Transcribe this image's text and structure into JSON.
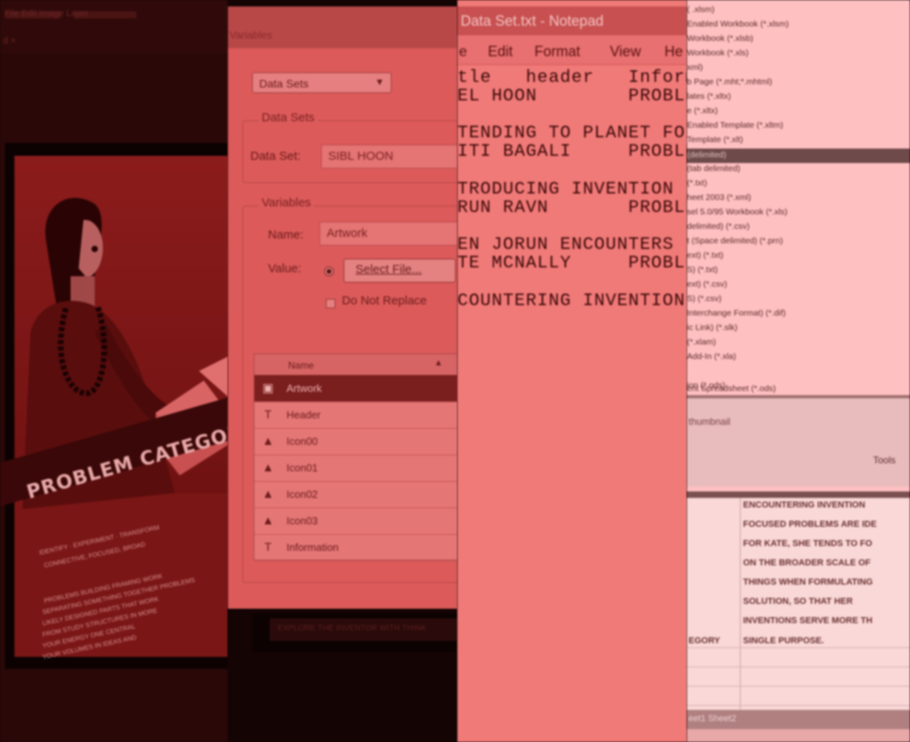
{
  "strip1": {
    "menu_text": "File  Edit  Image  Layer",
    "sub_text": "d  ×",
    "poster_title": "PROBLEM CATEGORY",
    "poster_lines": [
      "IDENTIFY  ·  EXPERIMENT  ·  TRANSFORM",
      "CONNECTIVE, FOCUSED, BROAD",
      "PROBLEMS  BUILDING  FRAMING  WORK",
      "SEPARATING  SOMETHING  TOGETHER  PROBLEMS",
      "LIKELY  DESIGNED  PARTS  THAT  WORK",
      "FROM  STUDY  STRUCTURES  IN  MORE",
      "YOUR  ENERGY  ONE  CENTRAL",
      "YOUR  VOLUMES  IN  IDEAS  AND"
    ],
    "colors": {
      "poster": "#7a1616",
      "band": "#3a0808"
    }
  },
  "strip2": {
    "title": "Variables",
    "combo_value": "Data Sets",
    "group_datasets": "Data Sets",
    "dataset_label": "Data Set:",
    "dataset_value": "SIBL HOON",
    "group_variables": "Variables",
    "name_label": "Name:",
    "name_value": "Artwork",
    "value_label": "Value:",
    "select_file": "Select File...",
    "do_not_replace": "Do Not Replace",
    "list_header": "Name",
    "list_sort": "▲",
    "rows": [
      {
        "icon": "▣",
        "name": "Artwork"
      },
      {
        "icon": "T",
        "name": "Header"
      },
      {
        "icon": "▲",
        "name": "Icon00"
      },
      {
        "icon": "▲",
        "name": "Icon01"
      },
      {
        "icon": "▲",
        "name": "Icon02"
      },
      {
        "icon": "▲",
        "name": "Icon03"
      },
      {
        "icon": "T",
        "name": "Information"
      }
    ],
    "lower_text": "EXPLORE THE INVENTOR WITH THINK"
  },
  "strip3": {
    "title": "Data Set.txt - Notepad",
    "menus": [
      "e",
      "Edit",
      "Format",
      "View",
      "He"
    ],
    "lines": [
      "tle   header   Inform",
      "EL HOON        PROBLE",
      "",
      "TENDING TO PLANET FO",
      "ITI BAGALI     PROBLE",
      "",
      "TRODUCING INVENTION",
      "RUN RAVN       PROBLE",
      "",
      "EN JORUN ENCOUNTERS",
      "TE MCNALLY     PROBLE",
      "",
      "COUNTERING INVENTION"
    ]
  },
  "strip4": {
    "file_types": [
      "( .xlsm)",
      "Enabled Workbook (*.xlsm)",
      "Workbook (*.xlsb)",
      "Workbook (*.xls)",
      "xml)",
      "b Page (*.mht;*.mhtml)",
      "lates (*.xltx)",
      "e (*.xltx)",
      "Enabled Template (*.xltm)",
      "Template (*.xlt)",
      "(tab delimited)",
      "(*.txt)",
      "heet 2003 (*.xml)",
      "sel 5.0/95 Workbook (*.xls)",
      "delimited) (*.csv)",
      "t (Space delimited) (*.prn)",
      "ext) (*.txt)",
      "S) (*.txt)",
      "ext) (*.csv)",
      "S) (*.csv)",
      "Interchange Format) (*.dif)",
      "ic Link) (*.slk)",
      "(*.xlam)",
      "Add-In (*.xla)",
      "",
      "ion (*.ods)",
      "ent Spreadsheet (*.ods)"
    ],
    "selected_item": "(delimited)",
    "panel_title": "thumbnail",
    "tools": "Tools",
    "cell_lines": [
      "ENCOUNTERING INVENTION",
      "FOCUSED PROBLEMS ARE IDE",
      "FOR KATE, SHE TENDS TO FO",
      "ON THE BROADER SCALE OF",
      "THINGS WHEN FORMULATING",
      "SOLUTION, SO THAT HER",
      "INVENTIONS SERVE MORE TH",
      "SINGLE PURPOSE."
    ],
    "left_cell": "EGORY",
    "sheet_tab": "eet1  Sheet2"
  }
}
